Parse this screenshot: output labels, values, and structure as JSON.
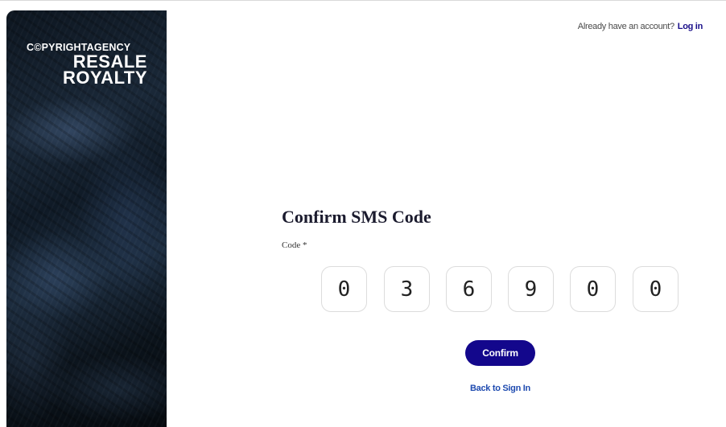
{
  "brand": {
    "line1": "C©PYRIGHTAGENCY",
    "line2": "RESALE",
    "line3": "ROYALTY"
  },
  "header": {
    "prompt": "Already have an account?",
    "login_label": "Log in"
  },
  "form": {
    "title": "Confirm SMS Code",
    "code_label": "Code *",
    "digits": [
      "0",
      "3",
      "6",
      "9",
      "0",
      "0"
    ],
    "confirm_label": "Confirm",
    "back_label": "Back to Sign In"
  },
  "colors": {
    "primary": "#13078c",
    "link": "#1f4bb0",
    "panel_dark": "#0f1a26"
  }
}
